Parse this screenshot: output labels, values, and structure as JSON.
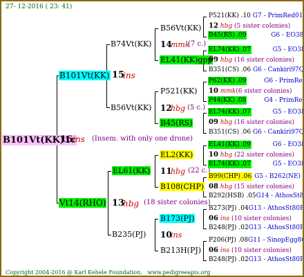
{
  "header": {
    "date": "27- 12-2016 ( 23: 41)"
  },
  "root": {
    "name": "B101Vt(KK)1c",
    "num": "16",
    "tag": "ins",
    "note": "(Insem. with only one drone)"
  },
  "sire": {
    "name": "B101Vt(KK)",
    "num": "15",
    "tag": "ins"
  },
  "dam": {
    "name": "Vt14(RHO)",
    "num": "13",
    "tag": "hbg",
    "note": "(18 sister colonies)"
  },
  "ss": {
    "name": "B74Vt(KK)",
    "num": "14",
    "tag": "mmk",
    "note": "(7 c.)"
  },
  "sd": {
    "name": "B56Vt(KK)",
    "num": "12",
    "tag": "hbg",
    "note": "(5 c.)"
  },
  "ds": {
    "name": "EL61(KK)",
    "num": "11",
    "tag": "hbg",
    "note": "(22 c.)"
  },
  "dd": {
    "name": "B235(PJ)"
  },
  "g3": [
    {
      "name": "B56Vt(KK)"
    },
    {
      "name": "EL41(KK)gpp"
    },
    {
      "name": "P521(KK)"
    },
    {
      "name": "B45(RS)"
    },
    {
      "name": "EL2(KK)"
    },
    {
      "name": "B108(CHP)"
    },
    {
      "name": "B173(PJ)",
      "num": "10",
      "tag": "ins"
    },
    {
      "name": "B213H(PJ)"
    }
  ],
  "g4": [
    {
      "name": "P521(KK)",
      "num": ".10",
      "src": "G7 - PrimRed01"
    },
    {
      "num": "12",
      "tag": "hbg",
      "note": "(5 sister colonies)"
    },
    {
      "name": "B45(RS)",
      "num": ".09",
      "src": "G6 - EO386"
    },
    {
      "name": "EL74(KK)",
      "num": ".07",
      "src": "G5 - EO386"
    },
    {
      "num": "09",
      "tag": "hbg",
      "note": "(16 sister colonies)"
    },
    {
      "name": "B351(CS)",
      "num": ".06",
      "src": "G6 - Cankiri97Q"
    },
    {
      "name": "P62(KK)",
      "num": ".09",
      "src": "G6 - PrimRed01"
    },
    {
      "num": "10",
      "tag": "mmk",
      "note": "(6 sister colonies)"
    },
    {
      "name": "P44(KK)",
      "num": ".08",
      "src": "G4 - PrimRed01"
    },
    {
      "name": "EL74(KK)",
      "num": ".07",
      "src": "G5 - EO386"
    },
    {
      "num": "09",
      "tag": "hbg",
      "note": "(16 sister colonies)"
    },
    {
      "name": "B351(CS)",
      "num": ".06",
      "src": "G6 - Cankiri97Q"
    },
    {
      "name": "EL41(KK)",
      "num": ".09",
      "src": "G6 - EO386"
    },
    {
      "num": "10",
      "tag": "hbg",
      "note": "(22 sister colonies)"
    },
    {
      "name": "EL74(KK)",
      "num": ".07",
      "src": "G5 - EO386"
    },
    {
      "name": "B99(CHP)",
      "num": ".06",
      "src": "G5 - B262(NE)"
    },
    {
      "num": "08",
      "tag": "hbg",
      "note": "(15 sister colonies)"
    },
    {
      "name": "B292(HSB)",
      "num": ".05",
      "src": "G14 - AthosSt80R"
    },
    {
      "name": "B273(PJ)",
      "num": ".04",
      "src": "G13 - AthosSt80R"
    },
    {
      "num": "06",
      "tag": "ins",
      "note": "(10 sister colonies)"
    },
    {
      "name": "B248(PJ)",
      "num": ".02",
      "src": "G13 - AthosSt80R"
    },
    {
      "name": "P206(PJ)",
      "num": ".08",
      "src": "G11 - SinopEgg86R"
    },
    {
      "num": "06",
      "tag": "ins",
      "note": "(10 sister colonies)"
    },
    {
      "name": "B248(PJ)",
      "num": ".02",
      "src": "G13 - AthosSt80R"
    }
  ],
  "footer": {
    "copyright": "Copyright 2004-2016 @ Karl Kehele Foundation.",
    "url": "www.pedigreeapis.org"
  }
}
